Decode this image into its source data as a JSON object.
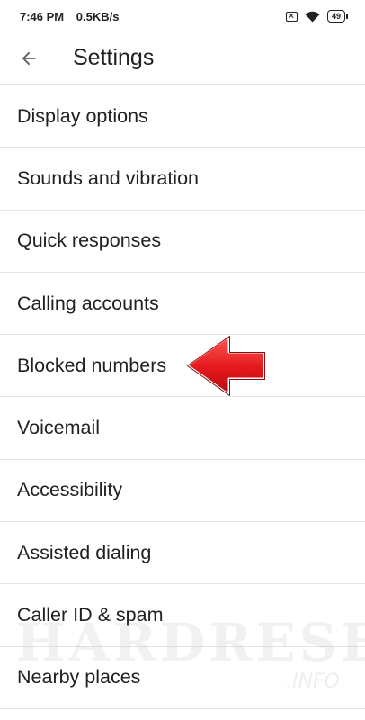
{
  "status_bar": {
    "time": "7:46 PM",
    "network_speed": "0.5KB/s",
    "battery_level": "49",
    "icons": [
      "sim-blocked-icon",
      "wifi-icon",
      "battery-icon"
    ]
  },
  "app_bar": {
    "back_icon": "arrow-back-icon",
    "title": "Settings"
  },
  "settings": {
    "items": [
      {
        "label": "Display options"
      },
      {
        "label": "Sounds and vibration"
      },
      {
        "label": "Quick responses"
      },
      {
        "label": "Calling accounts"
      },
      {
        "label": "Blocked numbers"
      },
      {
        "label": "Voicemail"
      },
      {
        "label": "Accessibility"
      },
      {
        "label": "Assisted dialing"
      },
      {
        "label": "Caller ID & spam"
      },
      {
        "label": "Nearby places"
      }
    ]
  },
  "overlay": {
    "arrow_icon": "red-pointer-arrow-icon",
    "arrow_color": "#e4171c"
  },
  "watermark": {
    "text": "HARDRESET",
    "sub": ".INFO"
  }
}
